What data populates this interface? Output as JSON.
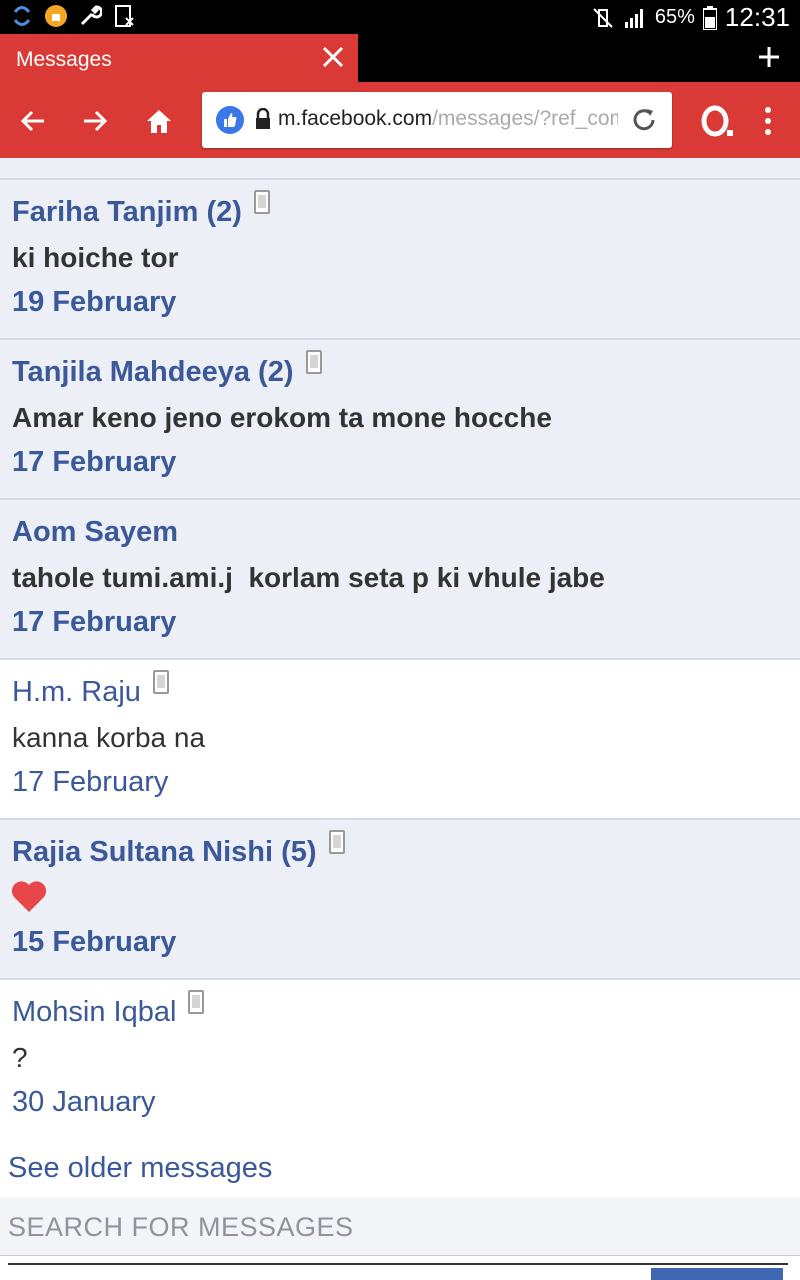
{
  "status_bar": {
    "battery": "65%",
    "time": "12:31"
  },
  "tab": {
    "title": "Messages"
  },
  "address_bar": {
    "url_host": "m.facebook.com",
    "url_path": "/messages/?ref_com"
  },
  "messages": [
    {
      "name": "Fariha Tanjim (2)",
      "snippet": "ki hoiche tor",
      "date": "19 February",
      "unread": true,
      "phone": true
    },
    {
      "name": "Tanjila Mahdeeya (2)",
      "snippet": "Amar keno jeno erokom ta mone hocche",
      "date": "17 February",
      "unread": true,
      "phone": true
    },
    {
      "name": "Aom Sayem",
      "snippet": "tahole tumi.ami.j  korlam seta p ki vhule jabe",
      "date": "17 February",
      "unread": true,
      "phone": false
    },
    {
      "name": "H.m. Raju",
      "snippet": "kanna korba na",
      "date": "17 February",
      "unread": false,
      "phone": true
    },
    {
      "name": "Rajia Sultana Nishi (5)",
      "snippet": "",
      "date": "15 February",
      "unread": true,
      "phone": true,
      "heart": true
    },
    {
      "name": "Mohsin Iqbal",
      "snippet": "?",
      "date": "30 January",
      "unread": false,
      "phone": true
    }
  ],
  "see_older": "See older messages",
  "search": {
    "placeholder": "SEARCH FOR MESSAGES"
  },
  "colors": {
    "brand_red": "#d93a35",
    "link_blue": "#3b5998",
    "unread_bg": "#eceff5"
  }
}
